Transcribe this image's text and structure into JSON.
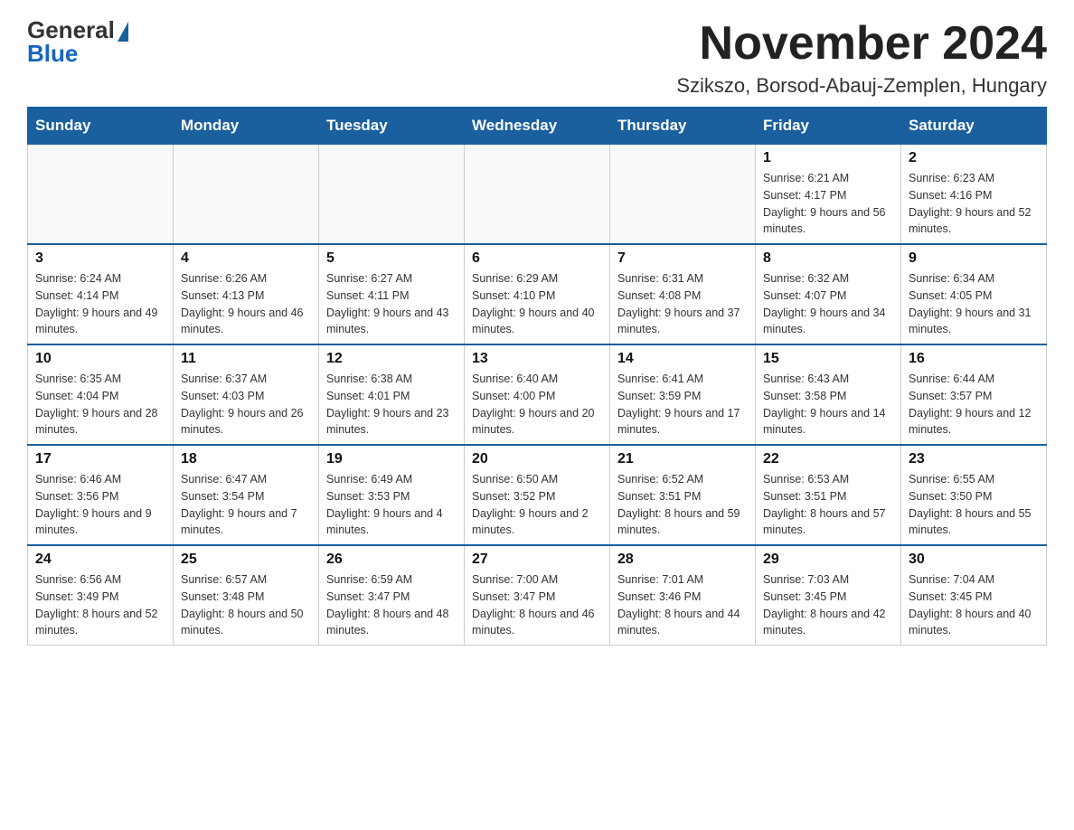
{
  "logo": {
    "general": "General",
    "blue": "Blue"
  },
  "title": "November 2024",
  "location": "Szikszo, Borsod-Abauj-Zemplen, Hungary",
  "weekdays": [
    "Sunday",
    "Monday",
    "Tuesday",
    "Wednesday",
    "Thursday",
    "Friday",
    "Saturday"
  ],
  "weeks": [
    [
      {
        "day": "",
        "info": ""
      },
      {
        "day": "",
        "info": ""
      },
      {
        "day": "",
        "info": ""
      },
      {
        "day": "",
        "info": ""
      },
      {
        "day": "",
        "info": ""
      },
      {
        "day": "1",
        "info": "Sunrise: 6:21 AM\nSunset: 4:17 PM\nDaylight: 9 hours and 56 minutes."
      },
      {
        "day": "2",
        "info": "Sunrise: 6:23 AM\nSunset: 4:16 PM\nDaylight: 9 hours and 52 minutes."
      }
    ],
    [
      {
        "day": "3",
        "info": "Sunrise: 6:24 AM\nSunset: 4:14 PM\nDaylight: 9 hours and 49 minutes."
      },
      {
        "day": "4",
        "info": "Sunrise: 6:26 AM\nSunset: 4:13 PM\nDaylight: 9 hours and 46 minutes."
      },
      {
        "day": "5",
        "info": "Sunrise: 6:27 AM\nSunset: 4:11 PM\nDaylight: 9 hours and 43 minutes."
      },
      {
        "day": "6",
        "info": "Sunrise: 6:29 AM\nSunset: 4:10 PM\nDaylight: 9 hours and 40 minutes."
      },
      {
        "day": "7",
        "info": "Sunrise: 6:31 AM\nSunset: 4:08 PM\nDaylight: 9 hours and 37 minutes."
      },
      {
        "day": "8",
        "info": "Sunrise: 6:32 AM\nSunset: 4:07 PM\nDaylight: 9 hours and 34 minutes."
      },
      {
        "day": "9",
        "info": "Sunrise: 6:34 AM\nSunset: 4:05 PM\nDaylight: 9 hours and 31 minutes."
      }
    ],
    [
      {
        "day": "10",
        "info": "Sunrise: 6:35 AM\nSunset: 4:04 PM\nDaylight: 9 hours and 28 minutes."
      },
      {
        "day": "11",
        "info": "Sunrise: 6:37 AM\nSunset: 4:03 PM\nDaylight: 9 hours and 26 minutes."
      },
      {
        "day": "12",
        "info": "Sunrise: 6:38 AM\nSunset: 4:01 PM\nDaylight: 9 hours and 23 minutes."
      },
      {
        "day": "13",
        "info": "Sunrise: 6:40 AM\nSunset: 4:00 PM\nDaylight: 9 hours and 20 minutes."
      },
      {
        "day": "14",
        "info": "Sunrise: 6:41 AM\nSunset: 3:59 PM\nDaylight: 9 hours and 17 minutes."
      },
      {
        "day": "15",
        "info": "Sunrise: 6:43 AM\nSunset: 3:58 PM\nDaylight: 9 hours and 14 minutes."
      },
      {
        "day": "16",
        "info": "Sunrise: 6:44 AM\nSunset: 3:57 PM\nDaylight: 9 hours and 12 minutes."
      }
    ],
    [
      {
        "day": "17",
        "info": "Sunrise: 6:46 AM\nSunset: 3:56 PM\nDaylight: 9 hours and 9 minutes."
      },
      {
        "day": "18",
        "info": "Sunrise: 6:47 AM\nSunset: 3:54 PM\nDaylight: 9 hours and 7 minutes."
      },
      {
        "day": "19",
        "info": "Sunrise: 6:49 AM\nSunset: 3:53 PM\nDaylight: 9 hours and 4 minutes."
      },
      {
        "day": "20",
        "info": "Sunrise: 6:50 AM\nSunset: 3:52 PM\nDaylight: 9 hours and 2 minutes."
      },
      {
        "day": "21",
        "info": "Sunrise: 6:52 AM\nSunset: 3:51 PM\nDaylight: 8 hours and 59 minutes."
      },
      {
        "day": "22",
        "info": "Sunrise: 6:53 AM\nSunset: 3:51 PM\nDaylight: 8 hours and 57 minutes."
      },
      {
        "day": "23",
        "info": "Sunrise: 6:55 AM\nSunset: 3:50 PM\nDaylight: 8 hours and 55 minutes."
      }
    ],
    [
      {
        "day": "24",
        "info": "Sunrise: 6:56 AM\nSunset: 3:49 PM\nDaylight: 8 hours and 52 minutes."
      },
      {
        "day": "25",
        "info": "Sunrise: 6:57 AM\nSunset: 3:48 PM\nDaylight: 8 hours and 50 minutes."
      },
      {
        "day": "26",
        "info": "Sunrise: 6:59 AM\nSunset: 3:47 PM\nDaylight: 8 hours and 48 minutes."
      },
      {
        "day": "27",
        "info": "Sunrise: 7:00 AM\nSunset: 3:47 PM\nDaylight: 8 hours and 46 minutes."
      },
      {
        "day": "28",
        "info": "Sunrise: 7:01 AM\nSunset: 3:46 PM\nDaylight: 8 hours and 44 minutes."
      },
      {
        "day": "29",
        "info": "Sunrise: 7:03 AM\nSunset: 3:45 PM\nDaylight: 8 hours and 42 minutes."
      },
      {
        "day": "30",
        "info": "Sunrise: 7:04 AM\nSunset: 3:45 PM\nDaylight: 8 hours and 40 minutes."
      }
    ]
  ]
}
